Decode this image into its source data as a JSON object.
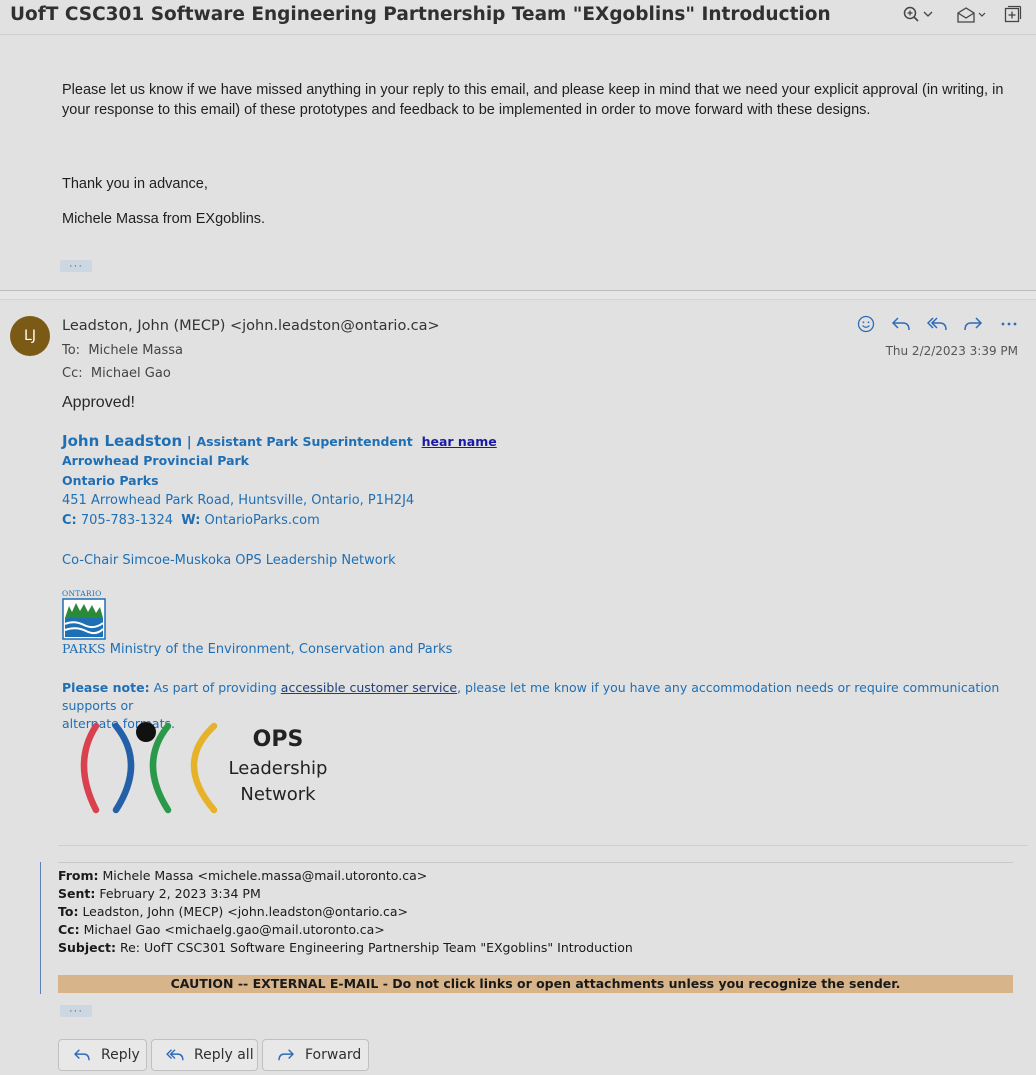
{
  "subject": "UofT CSC301 Software Engineering Partnership Team \"EXgoblins\" Introduction",
  "previous_message": {
    "paragraph1": "Please let us know if we have missed anything in your reply to this email, and please keep in mind that we need your explicit approval (in writing, in your response to this email) of these prototypes and feedback to be implemented in order to move forward with these designs.",
    "thanks": "Thank you in advance,",
    "signoff": "Michele Massa from EXgoblins."
  },
  "dots_label": "···",
  "message": {
    "avatar_initials": "LJ",
    "from": "Leadston, John (MECP) <john.leadston@ontario.ca>",
    "to_label": "To:",
    "to": "Michele Massa",
    "cc_label": "Cc:",
    "cc": "Michael Gao",
    "date": "Thu 2/2/2023 3:39 PM",
    "body": "Approved!"
  },
  "signature": {
    "name": "John Leadston",
    "separator": "|",
    "title": "Assistant Park Superintendent",
    "hear_name": "hear name",
    "park": "Arrowhead Provincial Park",
    "org": "Ontario Parks",
    "address": "451 Arrowhead Park Road, Huntsville, Ontario, P1H2J4",
    "cell_label": "C:",
    "cell": "705-783-1324",
    "web_label": "W:",
    "web": "OntarioParks.com",
    "cochair": "Co-Chair Simcoe-Muskoka OPS Leadership Network",
    "logo_ontario": "ONTARIO",
    "logo_parks": "PARKS",
    "ministry": "Ministry of the Environment, Conservation and Parks",
    "note_label": "Please note:",
    "note_pre": "As part of providing",
    "note_link": "accessible customer service",
    "note_post": ", please let me know if you have any accommodation needs or require communication supports or",
    "note_line2": "alternate formats.",
    "ops_line1": "OPS",
    "ops_line2": "Leadership",
    "ops_line3": "Network"
  },
  "quoted": {
    "from_label": "From:",
    "from": "Michele Massa <michele.massa@mail.utoronto.ca>",
    "sent_label": "Sent:",
    "sent": "February 2, 2023 3:34 PM",
    "to_label": "To:",
    "to": "Leadston, John (MECP) <john.leadston@ontario.ca>",
    "cc_label": "Cc:",
    "cc": "Michael Gao <michaelg.gao@mail.utoronto.ca>",
    "subject_label": "Subject:",
    "subject": "Re: UofT CSC301 Software Engineering Partnership Team \"EXgoblins\" Introduction",
    "caution": "CAUTION -- EXTERNAL E-MAIL - Do not click links or open attachments unless you recognize the sender."
  },
  "buttons": {
    "reply": "Reply",
    "reply_all": "Reply all",
    "forward": "Forward"
  },
  "colors": {
    "link_blue": "#1f6fb4",
    "avatar": "#7a5a15",
    "caution_bg": "#d7b48a",
    "icon_blue": "#2e6bb8"
  }
}
